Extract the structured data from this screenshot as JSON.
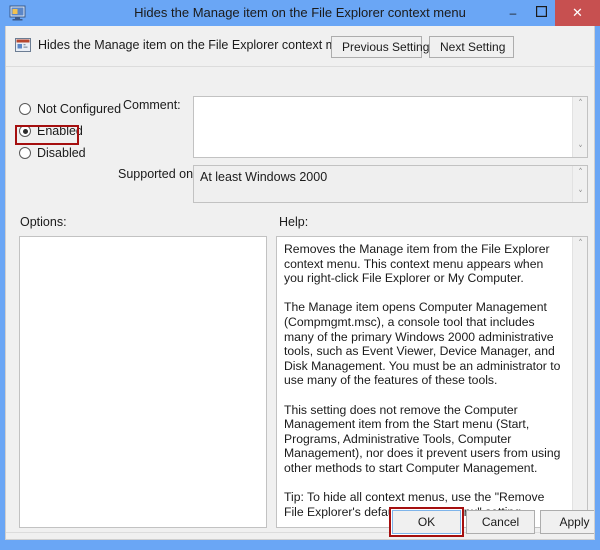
{
  "window": {
    "title": "Hides the Manage item on the File Explorer context menu",
    "icon": "group-policy-icon",
    "caption_buttons": [
      {
        "name": "minimize",
        "glyph": "–"
      },
      {
        "name": "maximize",
        "glyph": "❐"
      },
      {
        "name": "close",
        "glyph": "✕"
      }
    ]
  },
  "header": {
    "icon": "policy-setting-icon",
    "title": "Hides the Manage item on the File Explorer context menu",
    "previous_label": "Previous Setting",
    "next_label": "Next Setting"
  },
  "state": {
    "options": [
      {
        "label": "Not Configured",
        "checked": false
      },
      {
        "label": "Enabled",
        "checked": true
      },
      {
        "label": "Disabled",
        "checked": false
      }
    ],
    "selected": "Enabled"
  },
  "comment": {
    "label": "Comment:",
    "value": "",
    "placeholder": ""
  },
  "supported": {
    "label": "Supported on:",
    "value": "At least Windows 2000"
  },
  "options_panel": {
    "label": "Options:",
    "content": ""
  },
  "help_panel": {
    "label": "Help:",
    "text": "Removes the Manage item from the File Explorer context menu. This context menu appears when you right-click File Explorer or My Computer.\n\nThe Manage item opens Computer Management (Compmgmt.msc), a console tool that includes many of the primary Windows 2000 administrative tools, such as Event Viewer, Device Manager, and Disk Management. You must be an administrator to use many of the features of these tools.\n\nThis setting does not remove the Computer Management item from the Start menu (Start, Programs, Administrative Tools, Computer Management), nor does it prevent users from using other methods to start Computer Management.\n\nTip: To hide all context menus, use the \"Remove File Explorer's default context menu\" setting."
  },
  "footer": {
    "ok_label": "OK",
    "cancel_label": "Cancel",
    "apply_label": "Apply"
  },
  "scrollbar": {
    "up_glyph": "˄",
    "down_glyph": "˅"
  },
  "colors": {
    "frame": "#6aa6f5",
    "close_button": "#c75050",
    "dialog_bg": "#f0f0f0",
    "annotation_red": "#a50f0f",
    "focus_blue": "#7eb4ea"
  }
}
